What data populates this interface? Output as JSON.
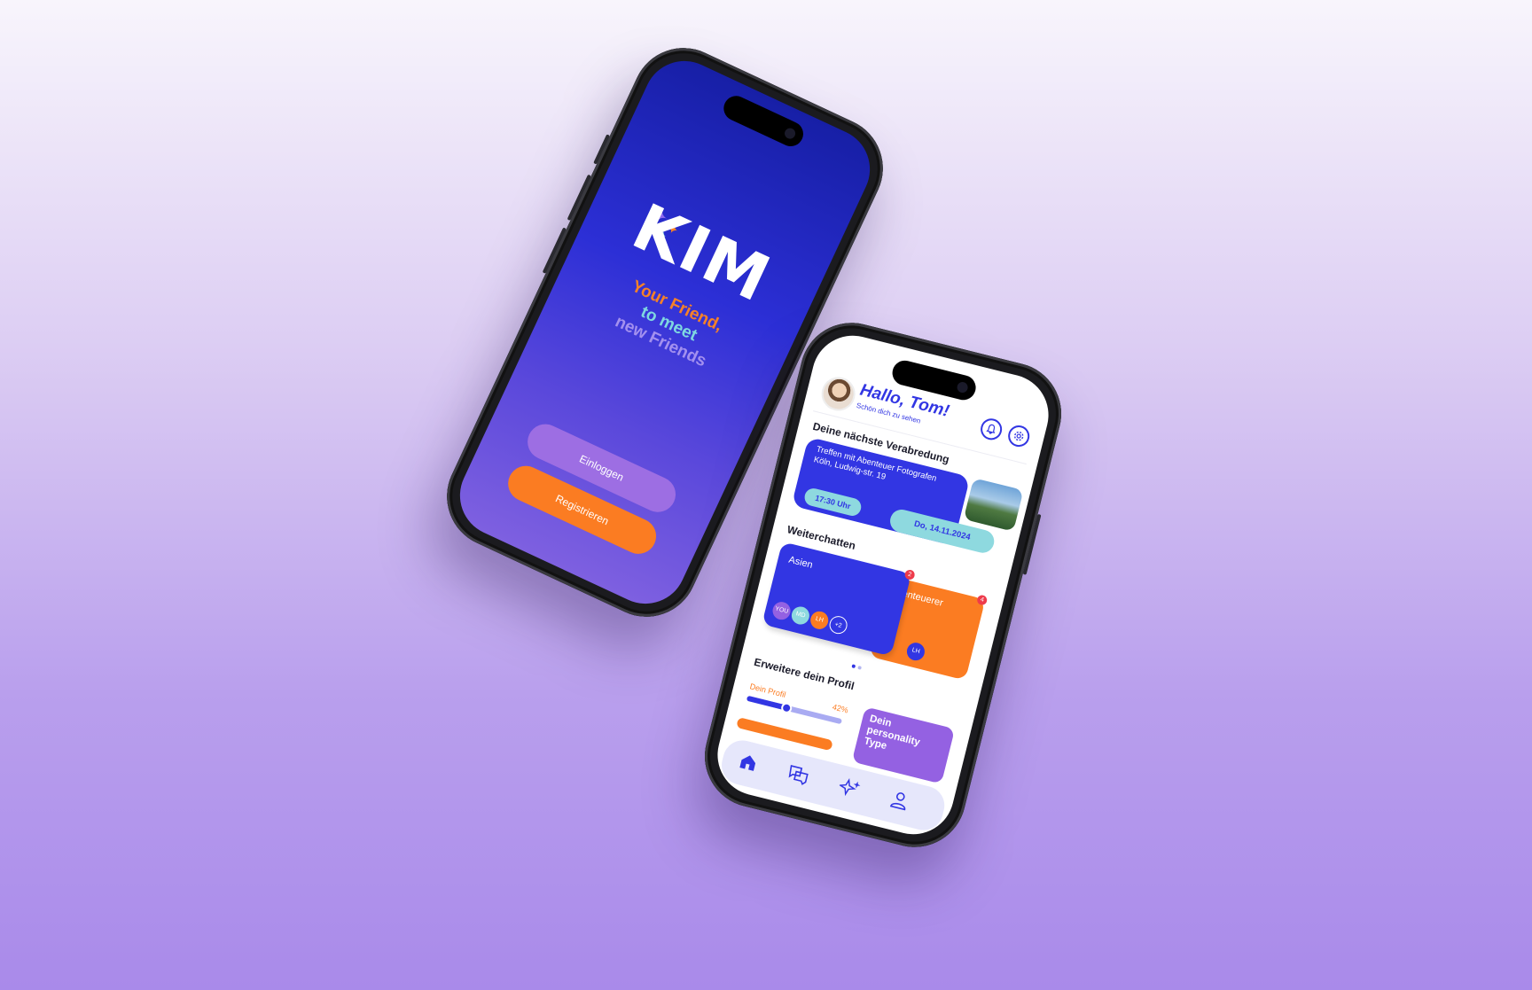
{
  "login": {
    "logo": "KIM",
    "tagline_1": "Your Friend,",
    "tagline_2": "to meet",
    "tagline_3": "new Friends",
    "login_button": "Einloggen",
    "register_button": "Registrieren"
  },
  "home": {
    "greeting": "Hallo, Tom!",
    "subtitle": "Schön dich zu sehen",
    "next_meeting": {
      "section_title": "Deine nächste Verabredung",
      "title": "Treffen mit Abenteuer Fotografen",
      "address": "Köln, Ludwig-str. 19",
      "time": "17:30 Uhr",
      "date": "Do, 14.11.2024"
    },
    "chats": {
      "section_title": "Weiterchatten",
      "items": [
        {
          "name": "Asien",
          "badge": "2",
          "members": [
            "YOU",
            "MD",
            "LH",
            "+2"
          ]
        },
        {
          "name": "Abenteuerer",
          "badge": "4",
          "members": [
            "LH"
          ]
        }
      ]
    },
    "profile": {
      "section_title": "Erweitere dein Profil",
      "label": "Dein Profil",
      "percent_label": "42%",
      "progress": 0.42,
      "personality_card": "Dein personality Type"
    },
    "nav": [
      "home-icon",
      "chat-icon",
      "sparkle-icon",
      "profile-icon"
    ]
  },
  "colors": {
    "primary_blue": "#3236e3",
    "orange": "#fb7c22",
    "purple": "#9461e2",
    "teal": "#8ed9df"
  }
}
